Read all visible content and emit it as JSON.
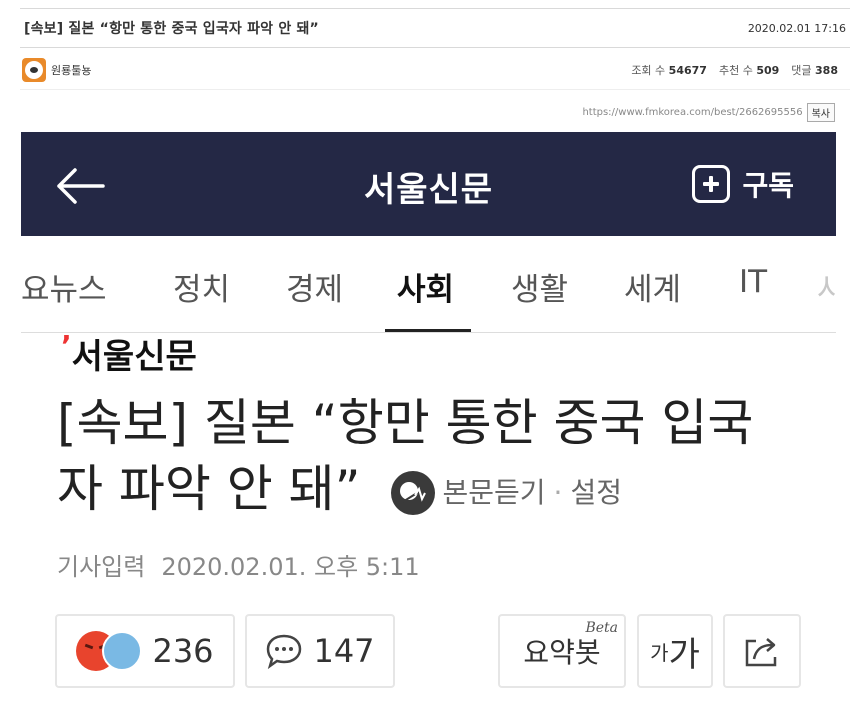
{
  "post": {
    "title": "[속보] 질본 “항만 통한 중국 입국자 파악 안 돼”",
    "datetime": "2020.02.01 17:16",
    "author": "원룡툴뇽",
    "views_label": "조회 수",
    "views": "54677",
    "likes_label": "추천 수",
    "likes": "509",
    "comments_label": "댓글",
    "comments": "388",
    "url": "https://www.fmkorea.com/best/2662695556",
    "copy_label": "복사"
  },
  "article": {
    "brand": "서울신문",
    "subscribe_label": "구독",
    "tabs": [
      "요뉴스",
      "정치",
      "경제",
      "사회",
      "생활",
      "세계",
      "IT",
      "사"
    ],
    "active_tab": "사회",
    "source_logo": "서울신문",
    "headline": "[속보] 질본 “항만 통한 중국 입국자 파악 안 돼”",
    "listen_label": "본문듣기",
    "settings_label": "설정",
    "date_label": "기사입력",
    "date_value": "2020.02.01. 오후 5:11",
    "reactions_count": "236",
    "comments_count": "147",
    "summary_label": "요약봇",
    "beta_label": "Beta",
    "font_small": "가",
    "font_big": "가"
  },
  "icons": {
    "back": "back-arrow-icon",
    "subscribe": "plus-box-icon",
    "listen": "speaker-head-icon",
    "comment": "speech-bubble-icon",
    "share": "share-icon"
  }
}
